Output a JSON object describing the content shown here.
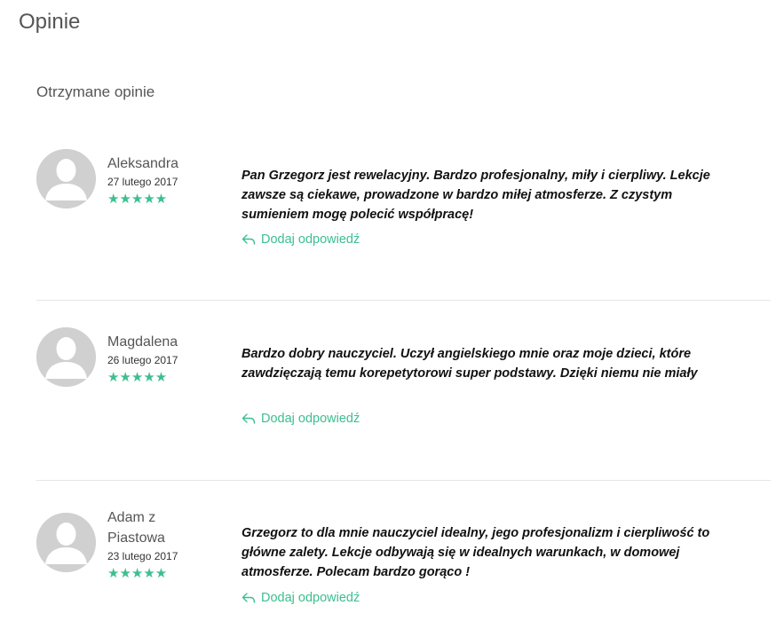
{
  "page": {
    "title": "Opinie"
  },
  "section": {
    "title": "Otrzymane opinie"
  },
  "reply_label": "Dodaj odpowiedź",
  "stars_text": "★★★★★",
  "colors": {
    "accent": "#3cbf8f",
    "avatar_bg": "#d0d0d0"
  },
  "reviews": [
    {
      "author": "Aleksandra",
      "date": "27 lutego 2017",
      "rating": 5,
      "text": "Pan Grzegorz jest rewelacyjny. Bardzo profesjonalny, miły i cierpliwy. Lekcje zawsze są ciekawe, prowadzone w bardzo miłej atmosferze. Z czystym sumieniem mogę polecić współpracę!"
    },
    {
      "author": "Magdalena",
      "date": "26 lutego 2017",
      "rating": 5,
      "text": "Bardzo dobry nauczyciel. Uczył angielskiego mnie oraz moje dzieci, które zawdzięczają temu korepetytorowi super podstawy. Dzięki niemu nie miały"
    },
    {
      "author": "Adam z Piastowa",
      "date": "23 lutego 2017",
      "rating": 5,
      "text": "Grzegorz to dla mnie nauczyciel idealny, jego profesjonalizm i cierpliwość to główne zalety. Lekcje odbywają się w idealnych warunkach, w domowej atmosferze. Polecam bardzo gorąco !"
    }
  ]
}
